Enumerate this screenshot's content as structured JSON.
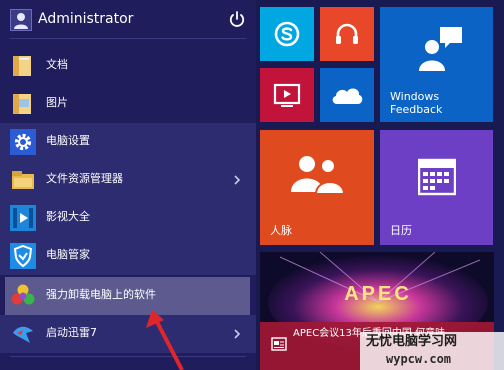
{
  "user": {
    "name": "Administrator"
  },
  "menu": {
    "items": [
      {
        "label": "文档",
        "icon": "folder-icon"
      },
      {
        "label": "图片",
        "icon": "folder-icon"
      },
      {
        "label": "电脑设置",
        "icon": "gear-icon"
      },
      {
        "label": "文件资源管理器",
        "icon": "file-explorer-icon",
        "has_submenu": true
      },
      {
        "label": "影视大全",
        "icon": "film-icon"
      },
      {
        "label": "电脑管家",
        "icon": "shield-icon"
      },
      {
        "label": "强力卸载电脑上的软件",
        "icon": "uninstaller-icon",
        "selected": true
      },
      {
        "label": "启动迅雷7",
        "icon": "thunder-icon",
        "has_submenu": true
      }
    ]
  },
  "tiles": {
    "skype": {
      "icon": "skype-icon",
      "color": "#00a7e1"
    },
    "music": {
      "icon": "headphones-icon",
      "color": "#e8472a"
    },
    "video": {
      "icon": "video-play-icon",
      "color": "#c2133a"
    },
    "onedrive": {
      "icon": "cloud-icon",
      "color": "#0b63c5"
    },
    "feedback": {
      "label": "Windows Feedback",
      "icon": "feedback-person-icon",
      "color": "#0b63c5"
    },
    "people": {
      "label": "人脉",
      "icon": "people-icon",
      "color": "#e04a1f"
    },
    "calendar": {
      "label": "日历",
      "icon": "calendar-icon",
      "color": "#6d3fc4"
    },
    "news": {
      "image_text": "APEC",
      "caption": "APEC会议13年后重回中国 何意味",
      "icon": "news-icon"
    }
  },
  "watermark": {
    "title": "无忧电脑学习网",
    "url": "wypcw.com"
  },
  "colors": {
    "menu_bg": "#1f1d5c",
    "selected_bg": "#5c5a8e",
    "arrow": "#e0252b"
  }
}
